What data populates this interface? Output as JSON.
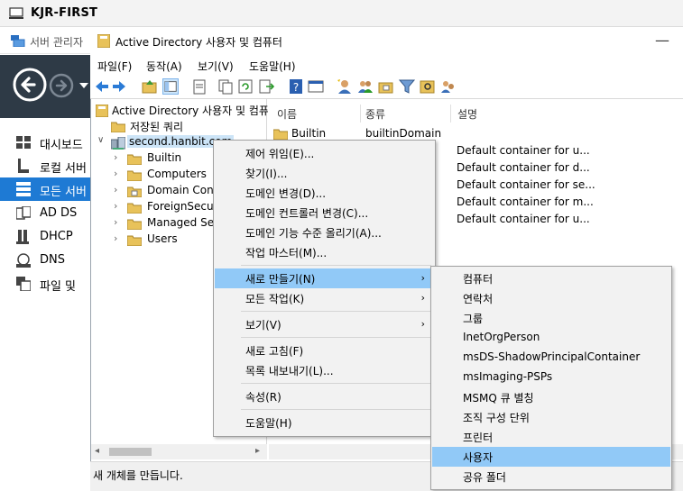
{
  "vm_window": {
    "title": "KJR-FIRST"
  },
  "server_manager": {
    "title": "서버 관리자",
    "nav": [
      {
        "label": "대시보드",
        "icon": "dashboard-icon"
      },
      {
        "label": "로컬 서버",
        "icon": "local-server-icon"
      },
      {
        "label": "모든 서버",
        "icon": "all-servers-icon",
        "selected": true
      },
      {
        "label": "AD DS",
        "icon": "ad-ds-icon"
      },
      {
        "label": "DHCP",
        "icon": "dhcp-icon"
      },
      {
        "label": "DNS",
        "icon": "dns-icon"
      },
      {
        "label": "파일 및",
        "icon": "file-storage-icon"
      }
    ]
  },
  "aduc": {
    "title": "Active Directory 사용자 및 컴퓨터",
    "menu": [
      "파일(F)",
      "동작(A)",
      "보기(V)",
      "도움말(H)"
    ],
    "tree": {
      "root": "Active Directory 사용자 및 컴퓨",
      "saved_queries": "저장된 쿼리",
      "domain": "second.hanbit.com",
      "children": [
        "Builtin",
        "Computers",
        "Domain Cont",
        "ForeignSecur",
        "Managed Se",
        "Users"
      ]
    },
    "list": {
      "columns": [
        "이름",
        "종류",
        "설명"
      ],
      "rows": [
        {
          "name": "Builtin",
          "type": "builtinDomain",
          "desc": ""
        },
        {
          "name": "",
          "type": "",
          "desc": "Default container for u..."
        },
        {
          "name": "",
          "type": "",
          "desc": "Default container for d..."
        },
        {
          "name": "",
          "type": "",
          "desc": "Default container for se..."
        },
        {
          "name": "",
          "type": "",
          "desc": "Default container for m..."
        },
        {
          "name": "",
          "type": "",
          "desc": "Default container for u..."
        }
      ]
    },
    "status": "새 개체를 만듭니다."
  },
  "context_menu": {
    "items": [
      {
        "label": "제어 위임(E)..."
      },
      {
        "label": "찾기(I)..."
      },
      {
        "label": "도메인 변경(D)..."
      },
      {
        "label": "도메인 컨트롤러 변경(C)..."
      },
      {
        "label": "도메인 기능 수준 올리기(A)..."
      },
      {
        "label": "작업 마스터(M)..."
      },
      {
        "label": "새로 만들기(N)",
        "submenu": true,
        "highlighted": true
      },
      {
        "label": "모든 작업(K)",
        "submenu": true
      },
      {
        "label": "보기(V)",
        "submenu": true
      },
      {
        "label": "새로 고침(F)"
      },
      {
        "label": "목록 내보내기(L)..."
      },
      {
        "label": "속성(R)"
      },
      {
        "label": "도움말(H)"
      }
    ]
  },
  "submenu": {
    "items": [
      "컴퓨터",
      "연락처",
      "그룹",
      "InetOrgPerson",
      "msDS-ShadowPrincipalContainer",
      "msImaging-PSPs",
      "MSMQ 큐 별칭",
      "조직 구성 단위",
      "프린터",
      "사용자",
      "공유 폴더"
    ],
    "highlighted": "사용자"
  },
  "colors": {
    "highlight": "#91c9f7",
    "nav_selected": "#1e7ad4",
    "nav_dark": "#2e3a46",
    "folder": "#e8c25a"
  }
}
